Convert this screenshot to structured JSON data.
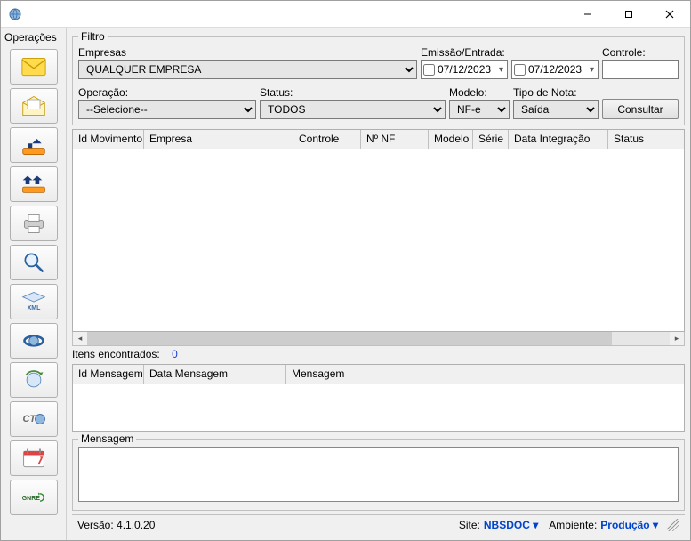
{
  "titlebar": {
    "title": ""
  },
  "sidebar": {
    "title": "Operações"
  },
  "filter": {
    "groupTitle": "Filtro",
    "empresasLabel": "Empresas",
    "empresasValue": "QUALQUER EMPRESA",
    "emissaoLabel": "Emissão/Entrada:",
    "date1": "07/12/2023",
    "date2": "07/12/2023",
    "controleLabel": "Controle:",
    "controleValue": "",
    "operacaoLabel": "Operação:",
    "operacaoValue": "--Selecione--",
    "statusLabel": "Status:",
    "statusValue": "TODOS",
    "modeloLabel": "Modelo:",
    "modeloValue": "NF-e",
    "tipoNotaLabel": "Tipo de Nota:",
    "tipoNotaValue": "Saída",
    "consultarLabel": "Consultar"
  },
  "grid": {
    "cols": [
      "Id Movimento",
      "Empresa",
      "Controle",
      "Nº NF",
      "Modelo",
      "Série",
      "Data Integração",
      "Status"
    ],
    "rows": []
  },
  "countLine": {
    "label": "Itens encontrados:",
    "value": "0"
  },
  "grid2": {
    "cols": [
      "Id Mensagem",
      "Data Mensagem",
      "Mensagem"
    ],
    "rows": []
  },
  "msg": {
    "groupTitle": "Mensagem",
    "value": ""
  },
  "status": {
    "version": "Versão: 4.1.0.20",
    "siteLabel": "Site:",
    "siteValue": "NBSDOC",
    "ambLabel": "Ambiente:",
    "ambValue": "Produção"
  }
}
